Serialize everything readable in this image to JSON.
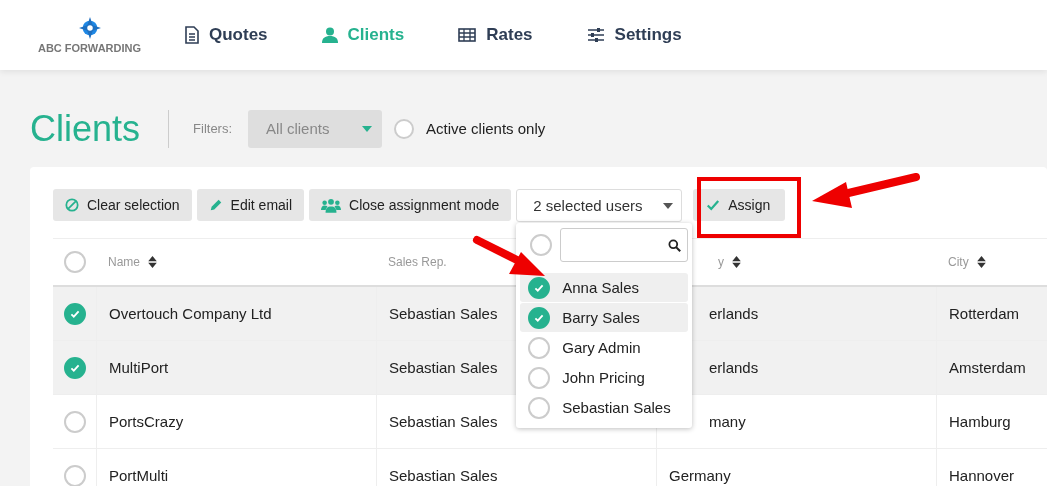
{
  "brand": {
    "name": "ABC FORWARDING"
  },
  "nav": [
    {
      "label": "Quotes",
      "selected": false
    },
    {
      "label": "Clients",
      "selected": true
    },
    {
      "label": "Rates",
      "selected": false
    },
    {
      "label": "Settings",
      "selected": false
    }
  ],
  "page_title": "Clients",
  "filters": {
    "label": "Filters:",
    "dropdown": "All clients",
    "active_only": {
      "label": "Active clients only",
      "checked": false
    }
  },
  "toolbar": [
    {
      "label": "Clear selection"
    },
    {
      "label": "Edit email"
    },
    {
      "label": "Close assignment mode"
    }
  ],
  "user_select": {
    "value": "2 selected users",
    "expanded": true,
    "all_checked": false,
    "options": [
      {
        "label": "Anna Sales",
        "checked": true
      },
      {
        "label": "Barry Sales",
        "checked": true
      },
      {
        "label": "Gary Admin",
        "checked": false
      },
      {
        "label": "John Pricing",
        "checked": false
      },
      {
        "label": "Sebastian Sales",
        "checked": false
      }
    ]
  },
  "assign_button": {
    "label": "Assign",
    "highlighted": true
  },
  "table": {
    "all_checked": false,
    "columns": [
      {
        "label": "Name",
        "sortable": true
      },
      {
        "label": "Sales Rep.",
        "sortable": false
      },
      {
        "label": "y",
        "sortable": true,
        "covered": true
      },
      {
        "label": "City",
        "sortable": true
      }
    ],
    "rows": [
      {
        "selected": true,
        "name": "Overtouch Company Ltd",
        "sales_rep": "Sebastian Sales",
        "country": "erlands",
        "country_covered": true,
        "city": "Rotterdam"
      },
      {
        "selected": true,
        "name": "MultiPort",
        "sales_rep": "Sebastian Sales",
        "country": "erlands",
        "country_covered": true,
        "city": "Amsterdam"
      },
      {
        "selected": false,
        "name": "PortsCrazy",
        "sales_rep": "Sebastian Sales",
        "country": "many",
        "country_covered": true,
        "city": "Hamburg"
      },
      {
        "selected": false,
        "name": "PortMulti",
        "sales_rep": "Sebastian Sales",
        "country": "Germany",
        "city": "Hannover"
      }
    ]
  },
  "annotations": [
    {
      "kind": "arrow"
    },
    {
      "kind": "arrow"
    }
  ]
}
